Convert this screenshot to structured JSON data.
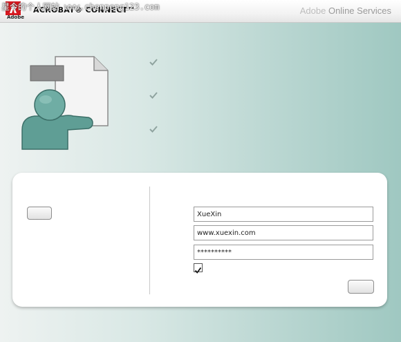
{
  "header": {
    "app_title": "ACROBAT® CONNECT™",
    "adobe_word": "Adobe",
    "services_brand": "Adobe",
    "services_label": " Online Services",
    "watermark": "星今的个人网站  www.chenpeng123.com"
  },
  "login": {
    "field1_value": "XueXin",
    "field2_value": "www.xuexin.com",
    "field3_value": "**********",
    "remember_checked": true
  },
  "colors": {
    "accent_teal": "#5f9e95",
    "adobe_red": "#d71920"
  },
  "icons": {
    "logo": "adobe-logo-icon",
    "illustration": "user-document-icon",
    "check": "check-icon"
  }
}
